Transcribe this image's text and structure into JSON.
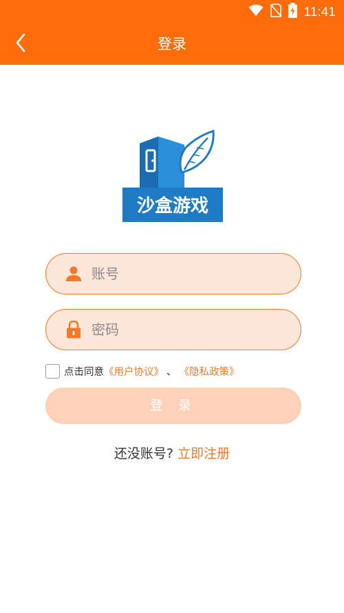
{
  "status_bar": {
    "time": "11:41",
    "icons": [
      "wifi-icon",
      "no-sim-icon",
      "battery-charging-icon"
    ]
  },
  "app_bar": {
    "title": "登录",
    "back_icon": "chevron-left-icon"
  },
  "logo": {
    "text": "沙盒游戏",
    "bg_color": "#1F7BC5",
    "icons": [
      "box-icon",
      "feather-icon"
    ]
  },
  "form": {
    "account": {
      "placeholder": "账号",
      "value": "",
      "icon": "user-icon"
    },
    "password": {
      "placeholder": "密码",
      "value": "",
      "icon": "lock-icon"
    },
    "agreement": {
      "prefix": "点击同意",
      "user_agreement": "《用户协议》",
      "separator": "、",
      "privacy_policy": "《隐私政策》",
      "checked": false
    },
    "login_label": "登 录"
  },
  "register": {
    "prompt": "还没账号?",
    "link": "立即注册"
  },
  "colors": {
    "primary": "#FE6D0C",
    "field_bg": "#FEE6D8",
    "button_disabled": "#FDD2B8",
    "link": "#F07A2A"
  }
}
